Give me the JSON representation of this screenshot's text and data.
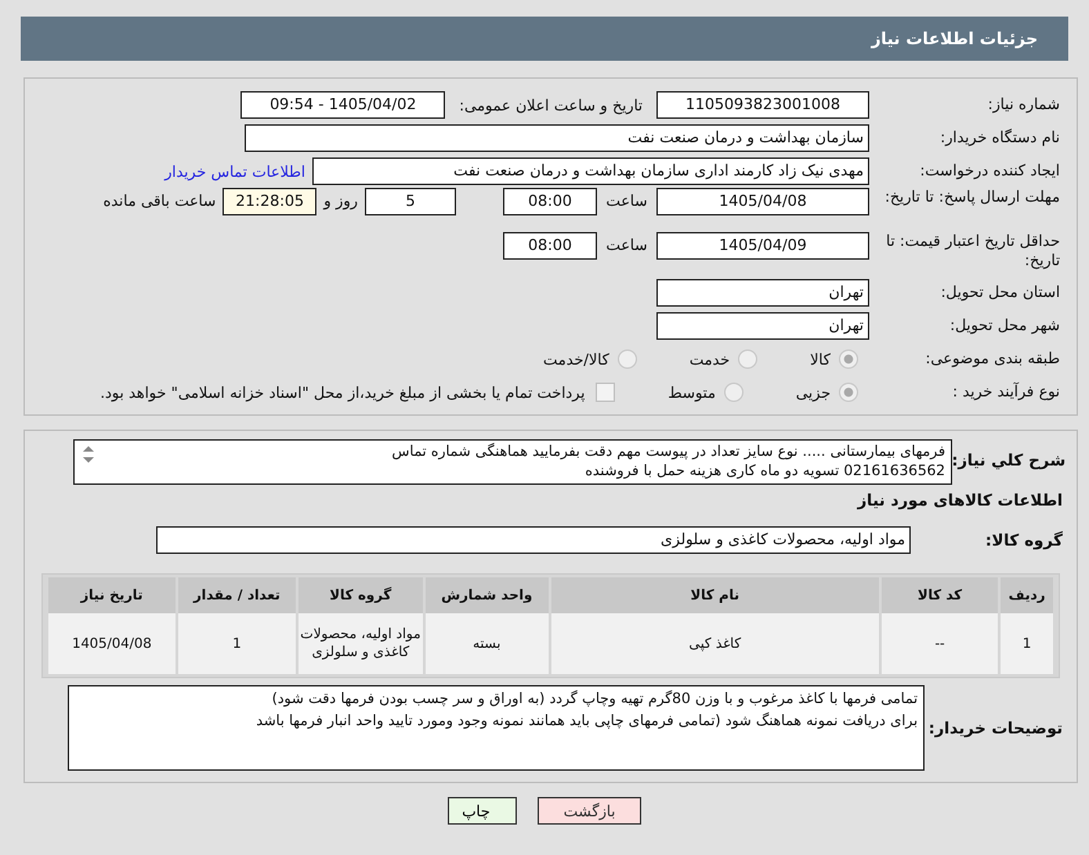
{
  "header": {
    "title": "جزئیات اطلاعات نیاز"
  },
  "details": {
    "need_number": {
      "label": "شماره نیاز:",
      "value": "1105093823001008"
    },
    "announce": {
      "label": "تاریخ و ساعت اعلان عمومی:",
      "value": "1405/04/02 - 09:54"
    },
    "buyer_org": {
      "label": "نام دستگاه خریدار:",
      "value": "سازمان بهداشت و درمان صنعت نفت"
    },
    "creator": {
      "label": "ایجاد کننده درخواست:",
      "value": "مهدی نیک زاد کارمند اداری سازمان بهداشت و درمان صنعت نفت",
      "link": "اطلاعات تماس خریدار"
    },
    "deadline": {
      "label": "مهلت ارسال پاسخ: تا تاریخ:",
      "date": "1405/04/08",
      "time_label": "ساعت",
      "time": "08:00",
      "days": "5",
      "days_label": "روز و",
      "remaining": "21:28:05",
      "remaining_label": "ساعت باقی مانده"
    },
    "validity": {
      "label": "حداقل تاریخ اعتبار قیمت: تا تاریخ:",
      "date": "1405/04/09",
      "time_label": "ساعت",
      "time": "08:00"
    },
    "province": {
      "label": "استان محل تحویل:",
      "value": "تهران"
    },
    "city": {
      "label": "شهر محل تحویل:",
      "value": "تهران"
    },
    "category": {
      "label": "طبقه بندی موضوعی:",
      "options": [
        {
          "label": "کالا",
          "selected": true
        },
        {
          "label": "خدمت",
          "selected": false
        },
        {
          "label": "کالا/خدمت",
          "selected": false
        }
      ]
    },
    "process": {
      "label": "نوع فرآیند خرید :",
      "options": [
        {
          "label": "جزیی",
          "selected": true
        },
        {
          "label": "متوسط",
          "selected": false
        }
      ],
      "treasury": {
        "label": "پرداخت تمام یا بخشی از مبلغ خرید،از محل \"اسناد خزانه اسلامی\" خواهد بود.",
        "checked": false
      }
    }
  },
  "goods": {
    "summary": {
      "label": "شرح كلي نياز:",
      "lines": [
        "فرمهای بیمارستانی  ..... نوع سایز تعداد در پیوست مهم دقت بفرمایید هماهنگی   شماره تماس",
        "02161636562 تسویه دو  ماه کاری هزینه حمل با فروشنده"
      ]
    },
    "heading": "اطلاعات کالاهای مورد نیاز",
    "group": {
      "label": "گروه کالا:",
      "value": "مواد اولیه، محصولات کاغذی و سلولزی"
    },
    "table": {
      "columns": [
        "ردیف",
        "کد کالا",
        "نام کالا",
        "واحد شمارش",
        "گروه کالا",
        "تعداد / مقدار",
        "تاریخ نیاز"
      ],
      "rows": [
        [
          "1",
          "--",
          "کاغذ کپی",
          "بسته",
          "مواد اولیه، محصولات کاغذی و سلولزی",
          "1",
          "1405/04/08"
        ]
      ]
    },
    "notes": {
      "label": "توضیحات خریدار:",
      "lines": [
        "تمامی فرمها با کاغذ مرغوب و با وزن 80گرم تهیه وچاپ گردد (به اوراق و سر چسب بودن فرمها دقت شود)",
        "برای دریافت نمونه هماهنگ شود (تمامی فرمهای چاپی باید همانند نمونه وجود ومورد تایید واحد انبار فرمها باشد"
      ]
    }
  },
  "buttons": [
    {
      "label": "بازگشت",
      "kind": "back"
    },
    {
      "label": "چاپ",
      "kind": "print"
    }
  ]
}
